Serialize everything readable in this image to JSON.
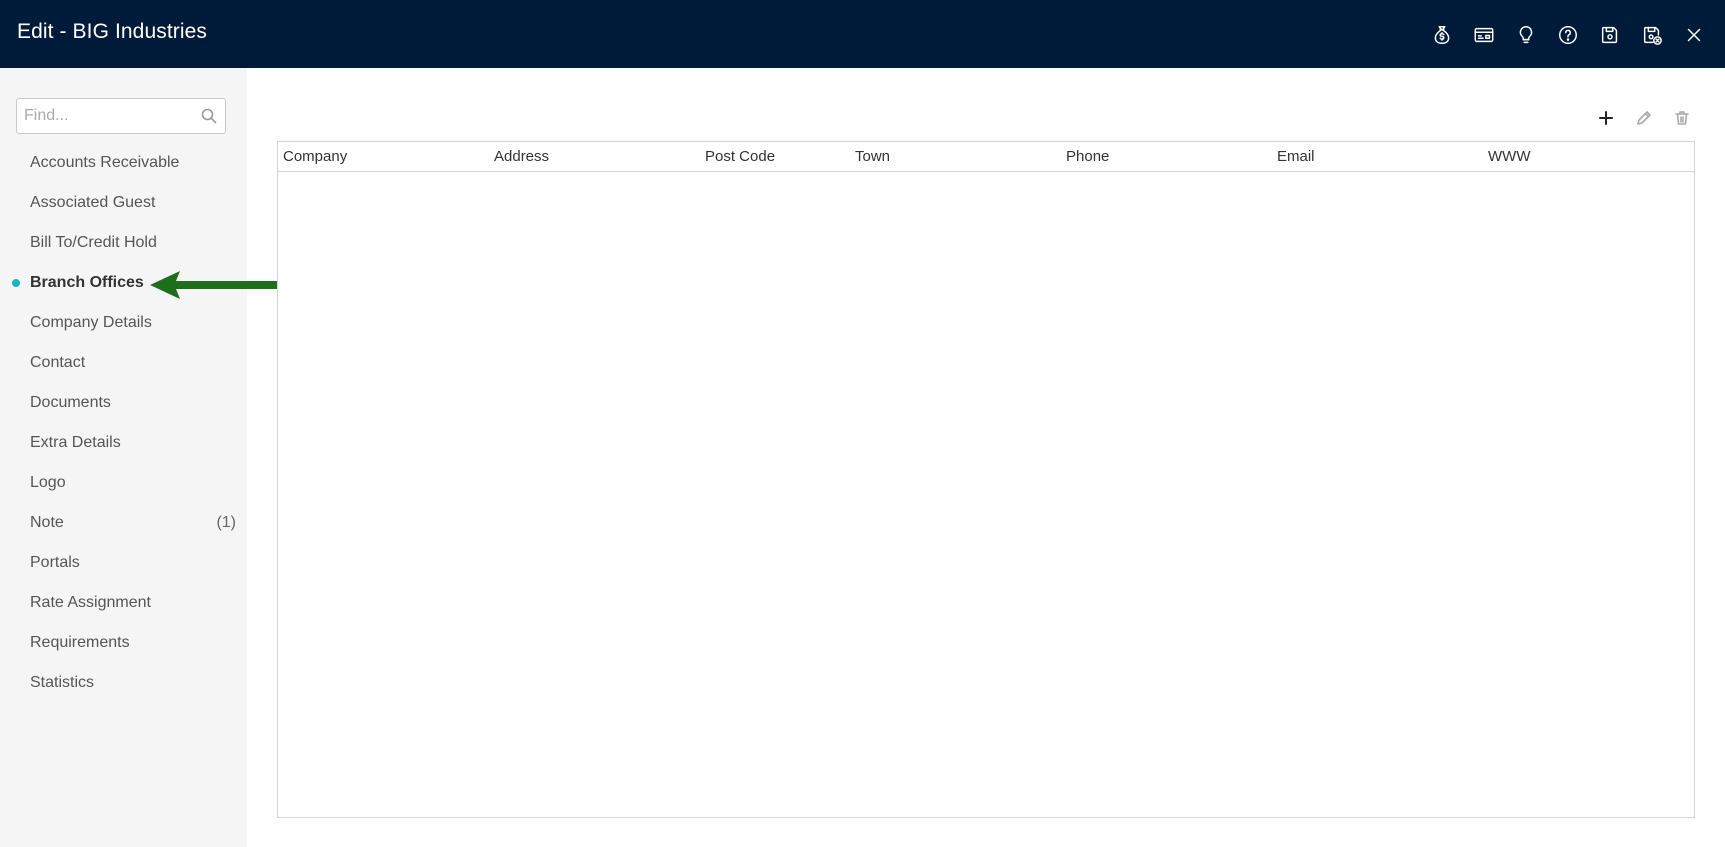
{
  "window": {
    "title": "Edit - BIG Industries"
  },
  "header_actions": [
    {
      "name": "money-bag-icon"
    },
    {
      "name": "credit-card-icon"
    },
    {
      "name": "lightbulb-icon"
    },
    {
      "name": "help-icon"
    },
    {
      "name": "save-icon"
    },
    {
      "name": "save-close-icon"
    },
    {
      "name": "close-icon"
    }
  ],
  "search": {
    "placeholder": "Find...",
    "value": ""
  },
  "sidebar": {
    "items": [
      {
        "label": "Accounts Receivable"
      },
      {
        "label": "Associated Guest"
      },
      {
        "label": "Bill To/Credit Hold"
      },
      {
        "label": "Branch Offices",
        "active": true
      },
      {
        "label": "Company Details"
      },
      {
        "label": "Contact"
      },
      {
        "label": "Documents"
      },
      {
        "label": "Extra Details"
      },
      {
        "label": "Logo"
      },
      {
        "label": "Note",
        "badge": "(1)"
      },
      {
        "label": "Portals"
      },
      {
        "label": "Rate Assignment"
      },
      {
        "label": "Requirements"
      },
      {
        "label": "Statistics"
      }
    ]
  },
  "toolbar": {
    "add_icon": "plus-icon",
    "edit_icon": "pencil-icon",
    "delete_icon": "trash-icon"
  },
  "grid": {
    "columns": [
      "Company",
      "Address",
      "Post Code",
      "Town",
      "Phone",
      "Email",
      "WWW"
    ],
    "rows": []
  },
  "colors": {
    "header_bg": "#001b3a",
    "sidebar_bg": "#f5f5f5",
    "active_dot": "#16b7c6",
    "annotation_arrow": "#1e6e1e"
  }
}
